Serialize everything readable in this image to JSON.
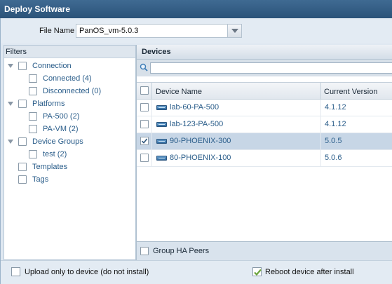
{
  "window": {
    "title": "Deploy Software"
  },
  "file": {
    "label": "File Name",
    "value": "PanOS_vm-5.0.3"
  },
  "filters": {
    "header": "Filters",
    "groups": [
      {
        "label": "Connection",
        "children": [
          {
            "label": "Connected (4)"
          },
          {
            "label": "Disconnected (0)"
          }
        ]
      },
      {
        "label": "Platforms",
        "children": [
          {
            "label": "PA-500 (2)"
          },
          {
            "label": "PA-VM (2)"
          }
        ]
      },
      {
        "label": "Device Groups",
        "children": [
          {
            "label": "test (2)"
          }
        ]
      }
    ],
    "leaves": [
      {
        "label": "Templates"
      },
      {
        "label": "Tags"
      }
    ]
  },
  "devices": {
    "header": "Devices",
    "search": {
      "value": "",
      "placeholder": ""
    },
    "columns": {
      "name": "Device Name",
      "version": "Current Version"
    },
    "rows": [
      {
        "name": "lab-60-PA-500",
        "version": "4.1.12",
        "checked": false
      },
      {
        "name": "lab-123-PA-500",
        "version": "4.1.12",
        "checked": false
      },
      {
        "name": "90-PHOENIX-300",
        "version": "5.0.5",
        "checked": true
      },
      {
        "name": "80-PHOENIX-100",
        "version": "5.0.6",
        "checked": false
      }
    ],
    "group_ha_label": "Group HA Peers"
  },
  "options": {
    "upload_only": {
      "label": "Upload only to device (do not install)",
      "checked": false
    },
    "reboot": {
      "label": "Reboot device after install",
      "checked": true
    }
  },
  "colors": {
    "titlebar": "#2b5379",
    "link_text": "#2a5d8a",
    "check_green": "#6aa33a",
    "selected_row": "#c7d6e6"
  }
}
